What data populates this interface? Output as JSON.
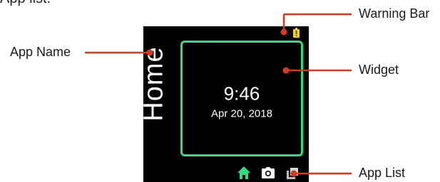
{
  "top_fragment": "App list.",
  "screen": {
    "app_name": "Home",
    "time": "9:46",
    "date": "Apr 20, 2018",
    "colors": {
      "background": "#000000",
      "widget_border": "#2de07f",
      "home_icon": "#2de07f",
      "battery_warning": "#f2d400"
    }
  },
  "annotations": {
    "warning_bar": "Warning Bar",
    "app_name": "App Name",
    "widget": "Widget",
    "app_list": "App List",
    "leader_color": "#d9391c"
  },
  "icons": [
    "battery-warning-icon",
    "home-icon",
    "camera-icon",
    "apps-icon"
  ]
}
